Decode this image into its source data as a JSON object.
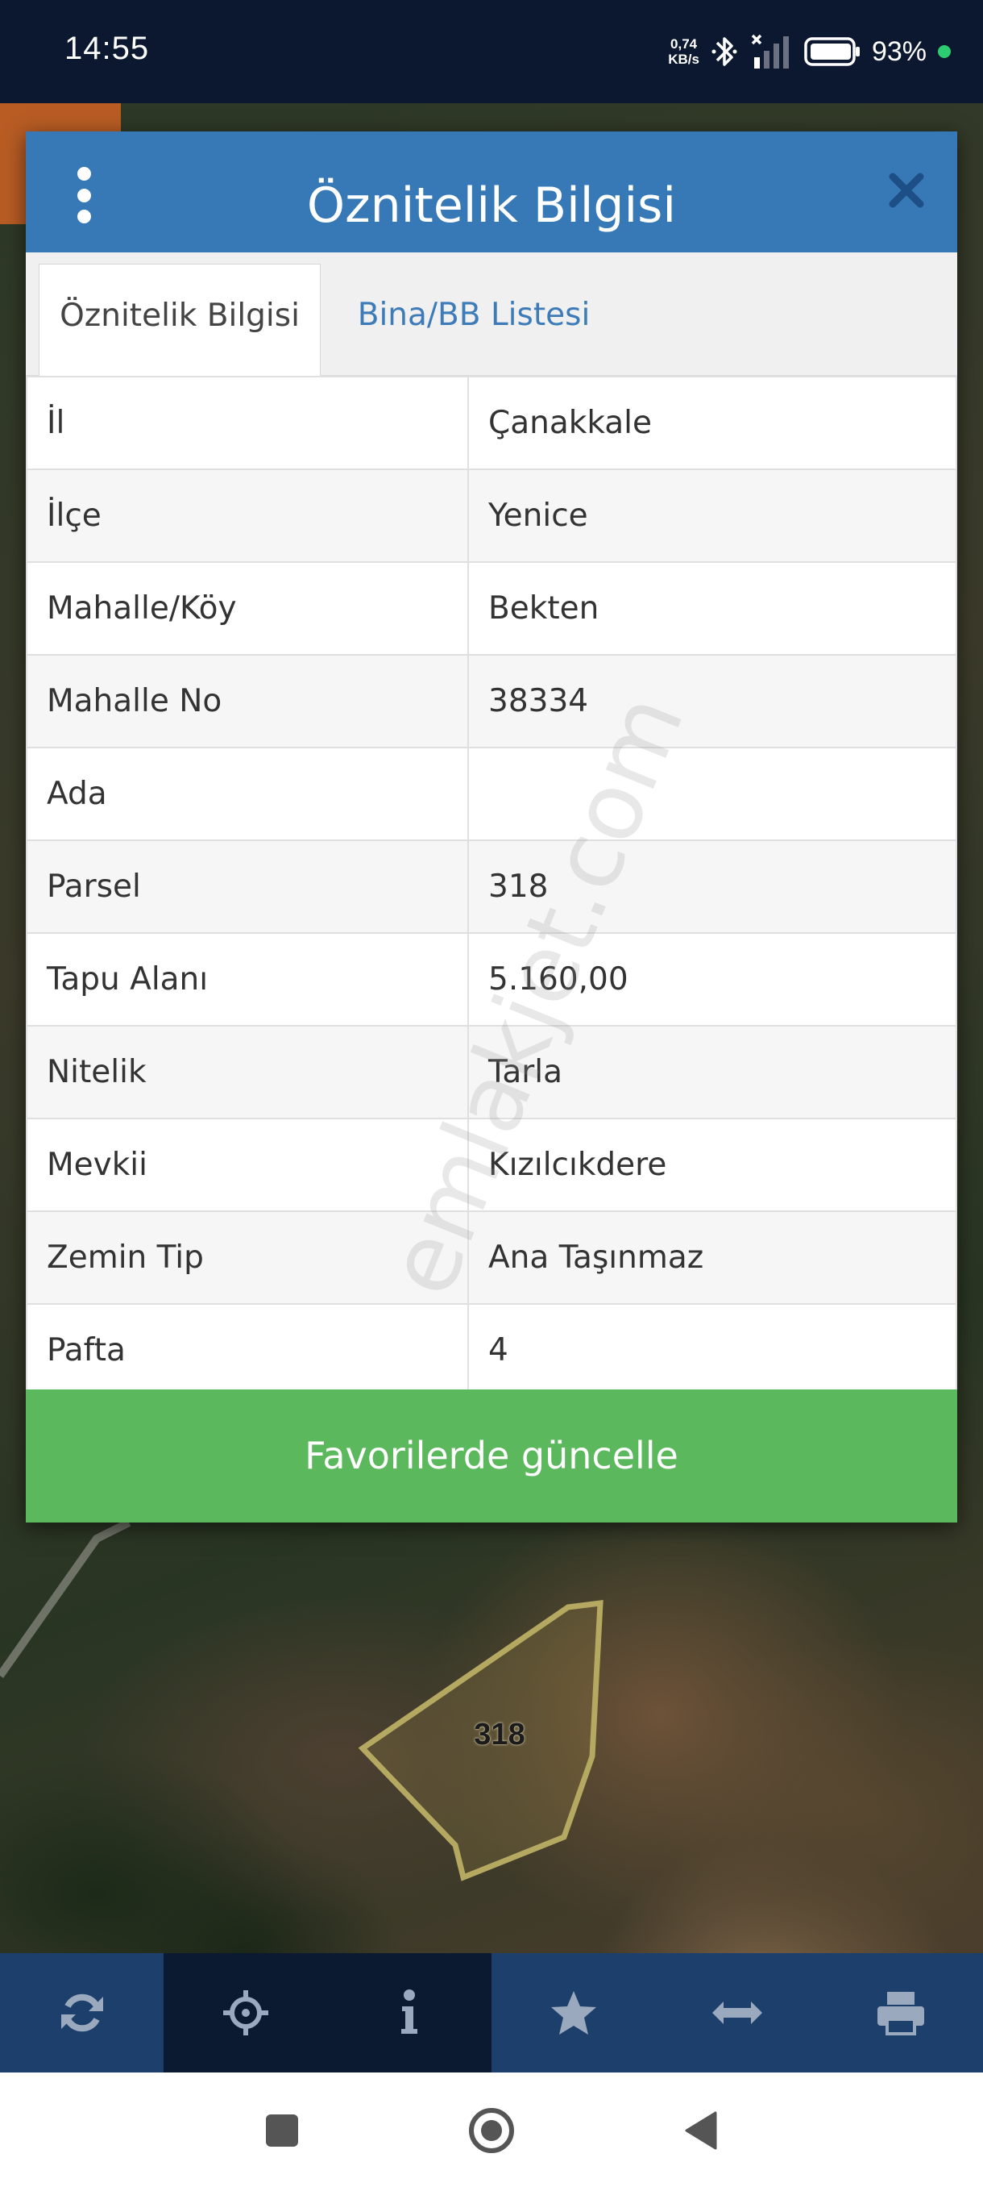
{
  "status_bar": {
    "time": "14:55",
    "net_speed_value": "0,74",
    "net_speed_unit": "KB/s",
    "battery_pct": "93%"
  },
  "map": {
    "parcel_label": "318"
  },
  "dialog": {
    "title": "Öznitelik Bilgisi",
    "tabs": [
      {
        "label": "Öznitelik Bilgisi",
        "active": true
      },
      {
        "label": "Bina/BB Listesi",
        "active": false
      }
    ],
    "rows": [
      {
        "key": "İl",
        "value": "Çanakkale"
      },
      {
        "key": "İlçe",
        "value": "Yenice"
      },
      {
        "key": "Mahalle/Köy",
        "value": "Bekten"
      },
      {
        "key": "Mahalle No",
        "value": "38334"
      },
      {
        "key": "Ada",
        "value": ""
      },
      {
        "key": "Parsel",
        "value": "318"
      },
      {
        "key": "Tapu Alanı",
        "value": "5.160,00"
      },
      {
        "key": "Nitelik",
        "value": "Tarla"
      },
      {
        "key": "Mevkii",
        "value": "Kızılcıkdere"
      },
      {
        "key": "Zemin Tip",
        "value": "Ana Taşınmaz"
      },
      {
        "key": "Pafta",
        "value": "4"
      }
    ],
    "watermark": "emlakjet.com",
    "favorite_button_label": "Favorilerde güncelle"
  },
  "toolbar": {
    "icons": [
      "refresh-icon",
      "crosshair-icon",
      "info-icon",
      "star-icon",
      "arrows-horizontal-icon",
      "printer-icon"
    ]
  },
  "colors": {
    "header_blue": "#3779b6",
    "tab_link_blue": "#3d7cb8",
    "button_green": "#5cb85c",
    "status_bar_bg": "#0b1830",
    "toolbar_bg": "#1d3f6b",
    "toolbar_active_bg": "#0b1a30"
  }
}
